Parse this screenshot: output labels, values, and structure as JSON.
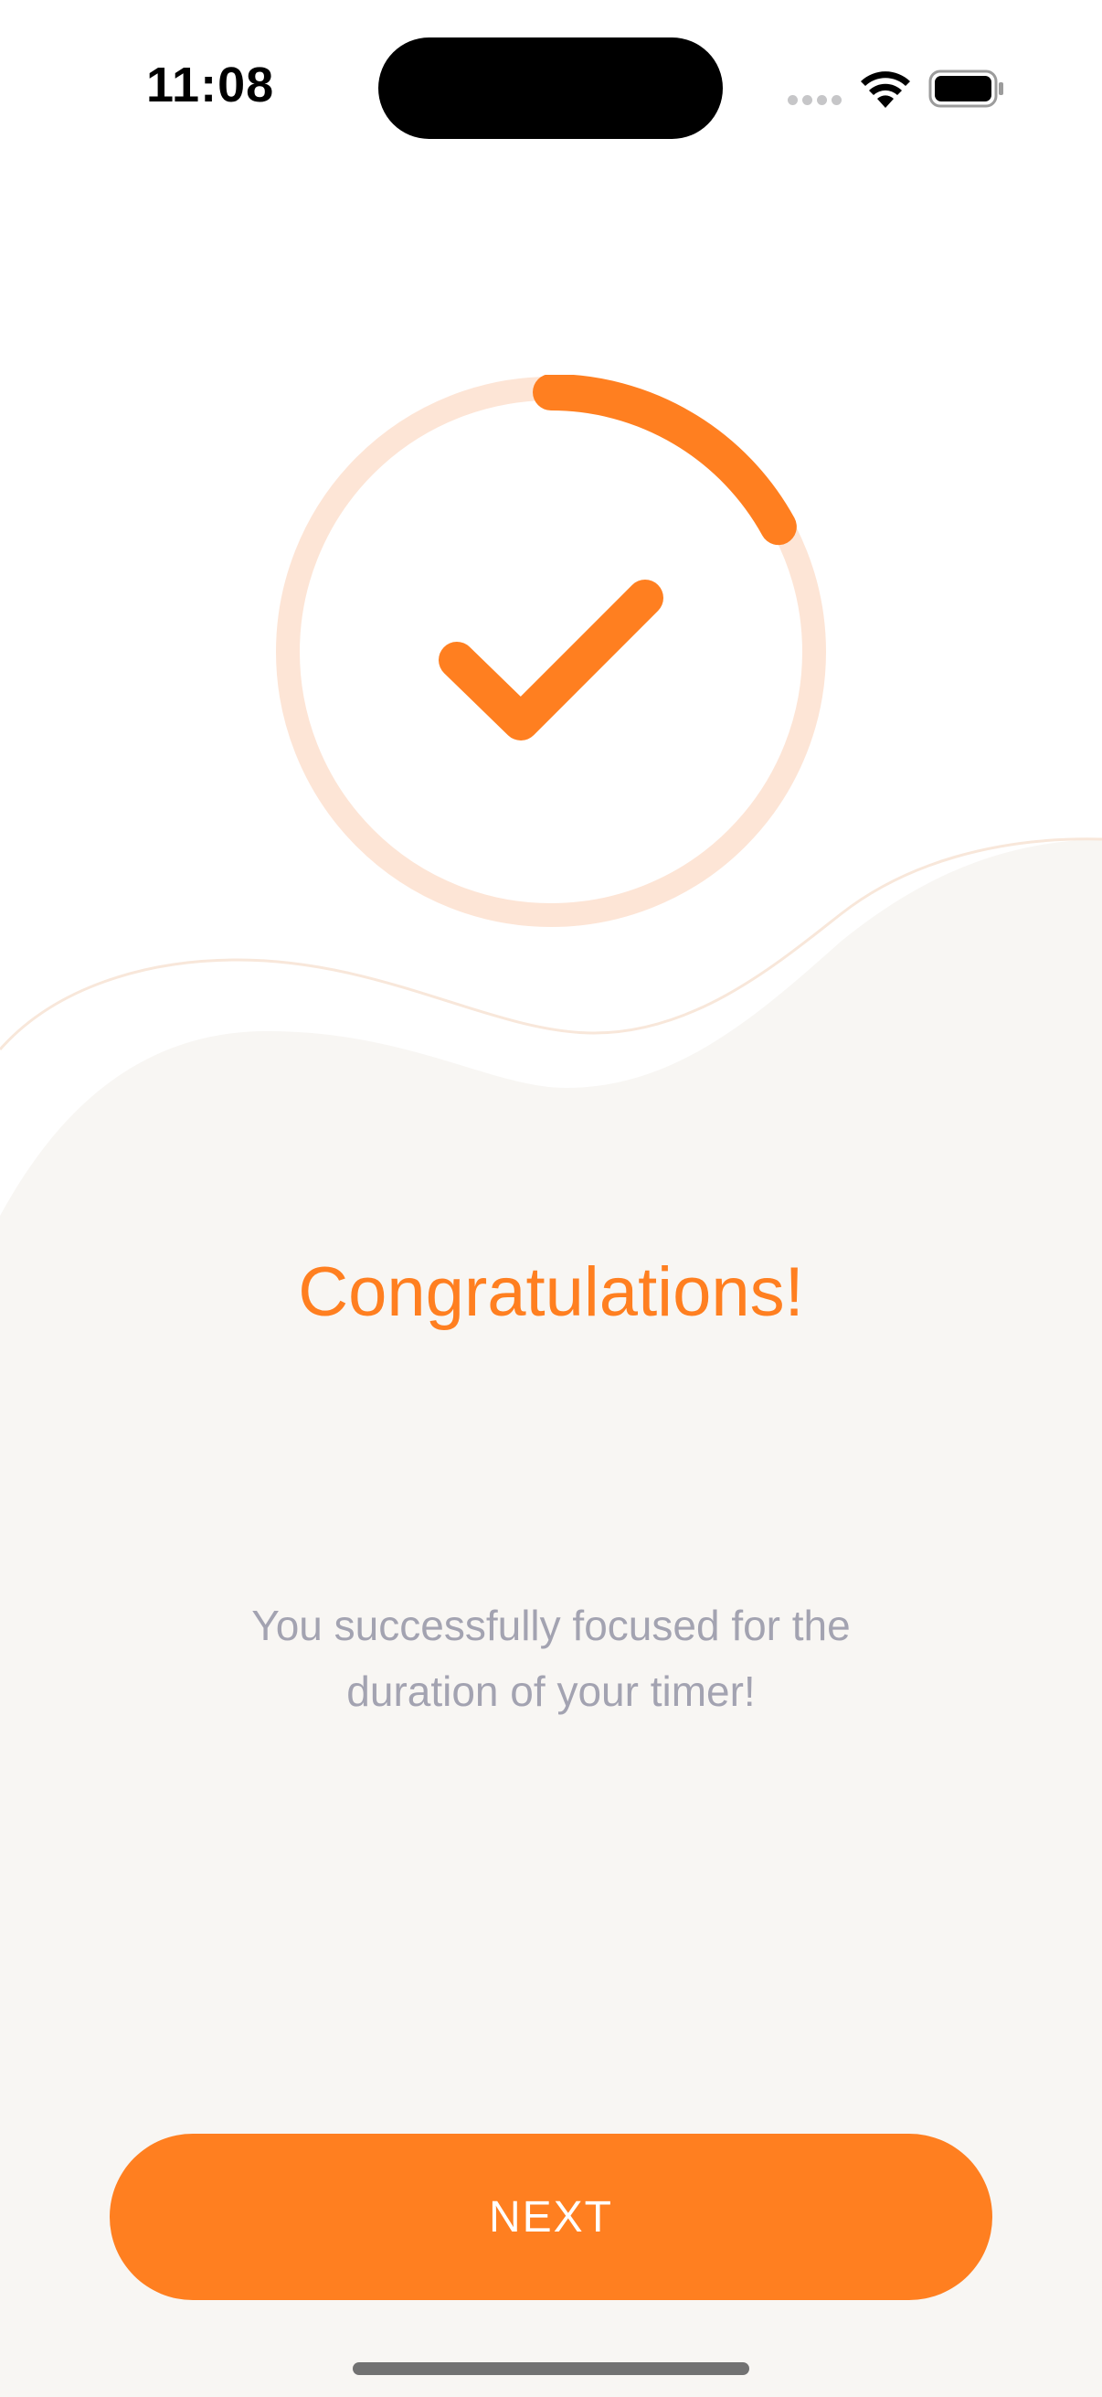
{
  "status_bar": {
    "time": "11:08"
  },
  "progress": {
    "fraction_complete": 0.17,
    "icon": "checkmark-icon"
  },
  "completion": {
    "title": "Congratulations!",
    "message": "You successfully focused for the duration of your timer!"
  },
  "actions": {
    "next_label": "NEXT"
  },
  "colors": {
    "accent": "#ff7f20",
    "ring_track": "#fde5d6",
    "background_lower": "#f8f6f3",
    "message_text": "#a3a3b1"
  }
}
